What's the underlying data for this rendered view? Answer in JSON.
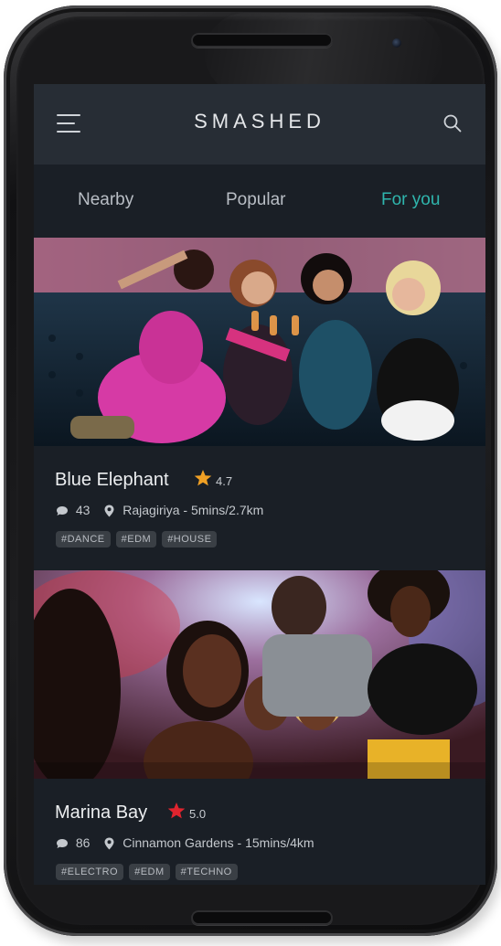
{
  "app": {
    "title": "SMASHED"
  },
  "tabs": [
    {
      "label": "Nearby",
      "active": false
    },
    {
      "label": "Popular",
      "active": false
    },
    {
      "label": "For you",
      "active": true
    }
  ],
  "venues": [
    {
      "name": "Blue Elephant",
      "rating": "4.7",
      "star_color": "#f0a024",
      "comments": "43",
      "location": "Rajagiriya - 5mins/2.7km",
      "tags": [
        "#DANCE",
        "#EDM",
        "#HOUSE"
      ]
    },
    {
      "name": "Marina Bay",
      "rating": "5.0",
      "star_color": "#e0242e",
      "comments": "86",
      "location": "Cinnamon Gardens - 15mins/4km",
      "tags": [
        "#ELECTRO",
        "#EDM",
        "#TECHNO"
      ]
    }
  ],
  "colors": {
    "accent": "#2fb5ad",
    "appbar": "#272d35",
    "background": "#1a1f26"
  },
  "icons": [
    "menu-icon",
    "search-icon",
    "star-icon",
    "comment-icon",
    "location-pin-icon"
  ]
}
